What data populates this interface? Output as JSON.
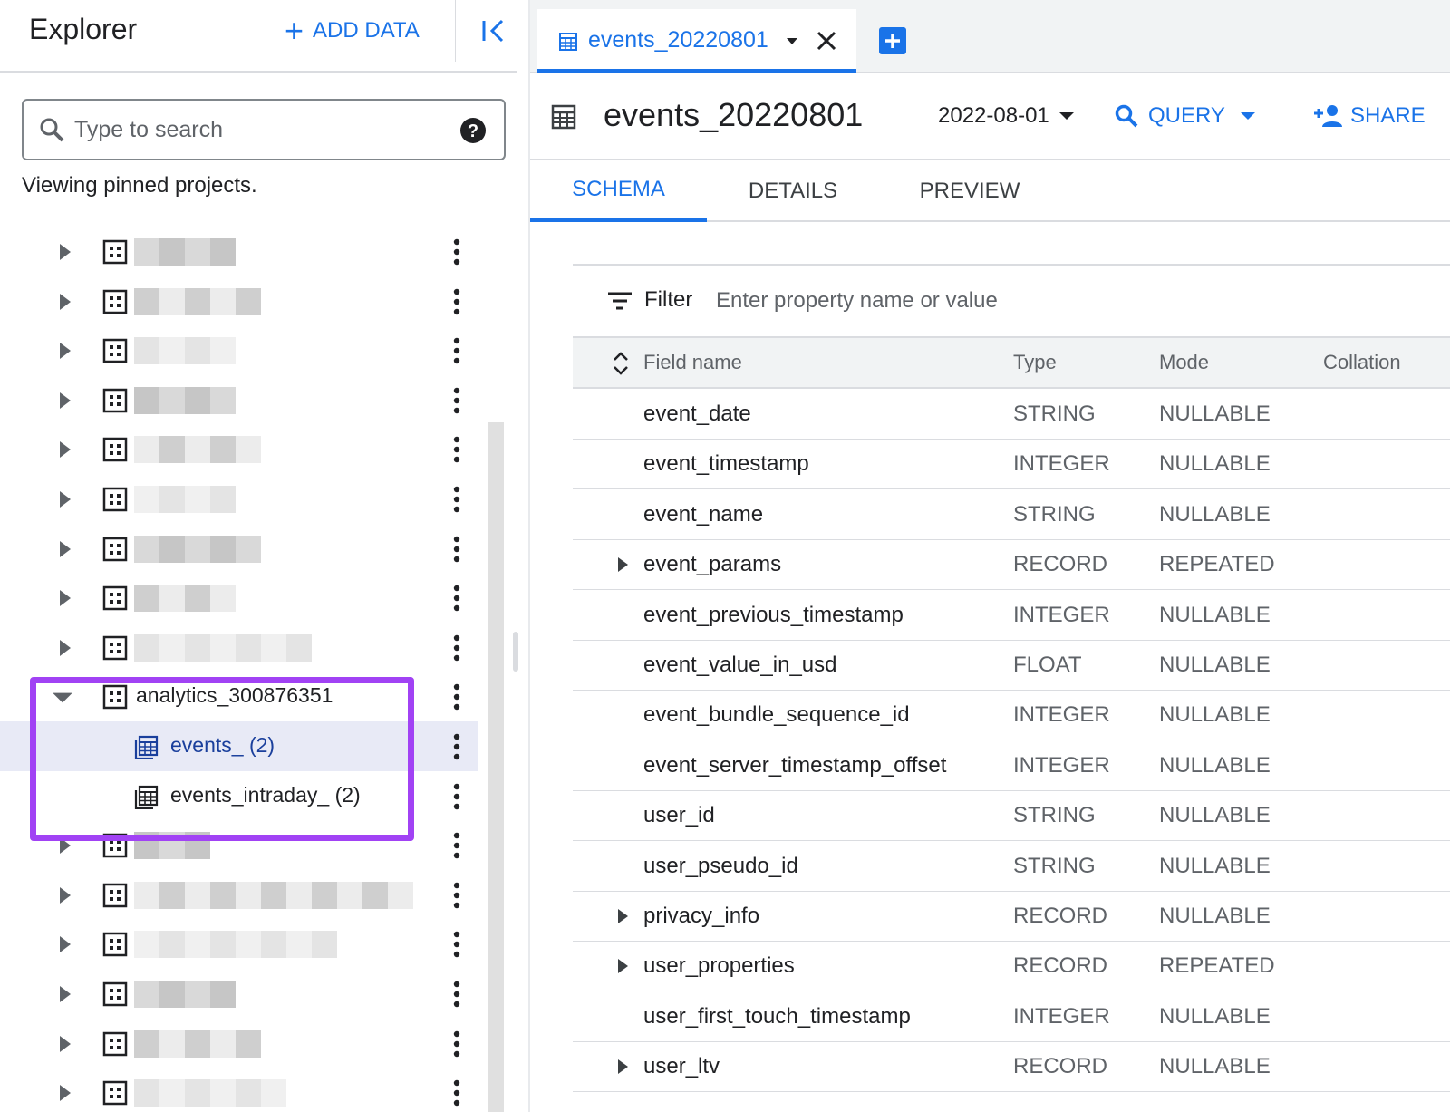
{
  "explorer": {
    "title": "Explorer",
    "add_data_label": "ADD DATA",
    "search_placeholder": "Type to search",
    "pinned_text": "Viewing pinned projects."
  },
  "tree": {
    "dataset_name": "analytics_300876351",
    "tables": [
      {
        "label": "events_ (2)",
        "selected": true
      },
      {
        "label": "events_intraday_ (2)",
        "selected": false
      }
    ]
  },
  "tab": {
    "title": "events_20220801"
  },
  "toolbar": {
    "table_name": "events_20220801",
    "date": "2022-08-01",
    "query_label": "QUERY",
    "share_label": "SHARE"
  },
  "subtabs": [
    "SCHEMA",
    "DETAILS",
    "PREVIEW"
  ],
  "filter": {
    "label": "Filter",
    "placeholder": "Enter property name or value"
  },
  "schema": {
    "columns": [
      "Field name",
      "Type",
      "Mode",
      "Collation"
    ],
    "rows": [
      {
        "field": "event_date",
        "type": "STRING",
        "mode": "NULLABLE",
        "expandable": false
      },
      {
        "field": "event_timestamp",
        "type": "INTEGER",
        "mode": "NULLABLE",
        "expandable": false
      },
      {
        "field": "event_name",
        "type": "STRING",
        "mode": "NULLABLE",
        "expandable": false
      },
      {
        "field": "event_params",
        "type": "RECORD",
        "mode": "REPEATED",
        "expandable": true
      },
      {
        "field": "event_previous_timestamp",
        "type": "INTEGER",
        "mode": "NULLABLE",
        "expandable": false
      },
      {
        "field": "event_value_in_usd",
        "type": "FLOAT",
        "mode": "NULLABLE",
        "expandable": false
      },
      {
        "field": "event_bundle_sequence_id",
        "type": "INTEGER",
        "mode": "NULLABLE",
        "expandable": false
      },
      {
        "field": "event_server_timestamp_offset",
        "type": "INTEGER",
        "mode": "NULLABLE",
        "expandable": false
      },
      {
        "field": "user_id",
        "type": "STRING",
        "mode": "NULLABLE",
        "expandable": false
      },
      {
        "field": "user_pseudo_id",
        "type": "STRING",
        "mode": "NULLABLE",
        "expandable": false
      },
      {
        "field": "privacy_info",
        "type": "RECORD",
        "mode": "NULLABLE",
        "expandable": true
      },
      {
        "field": "user_properties",
        "type": "RECORD",
        "mode": "REPEATED",
        "expandable": true
      },
      {
        "field": "user_first_touch_timestamp",
        "type": "INTEGER",
        "mode": "NULLABLE",
        "expandable": false
      },
      {
        "field": "user_ltv",
        "type": "RECORD",
        "mode": "NULLABLE",
        "expandable": true
      }
    ]
  },
  "colors": {
    "accent": "#1a73e8",
    "highlight": "#a142f4",
    "selected_row": "#e8eaf6"
  }
}
